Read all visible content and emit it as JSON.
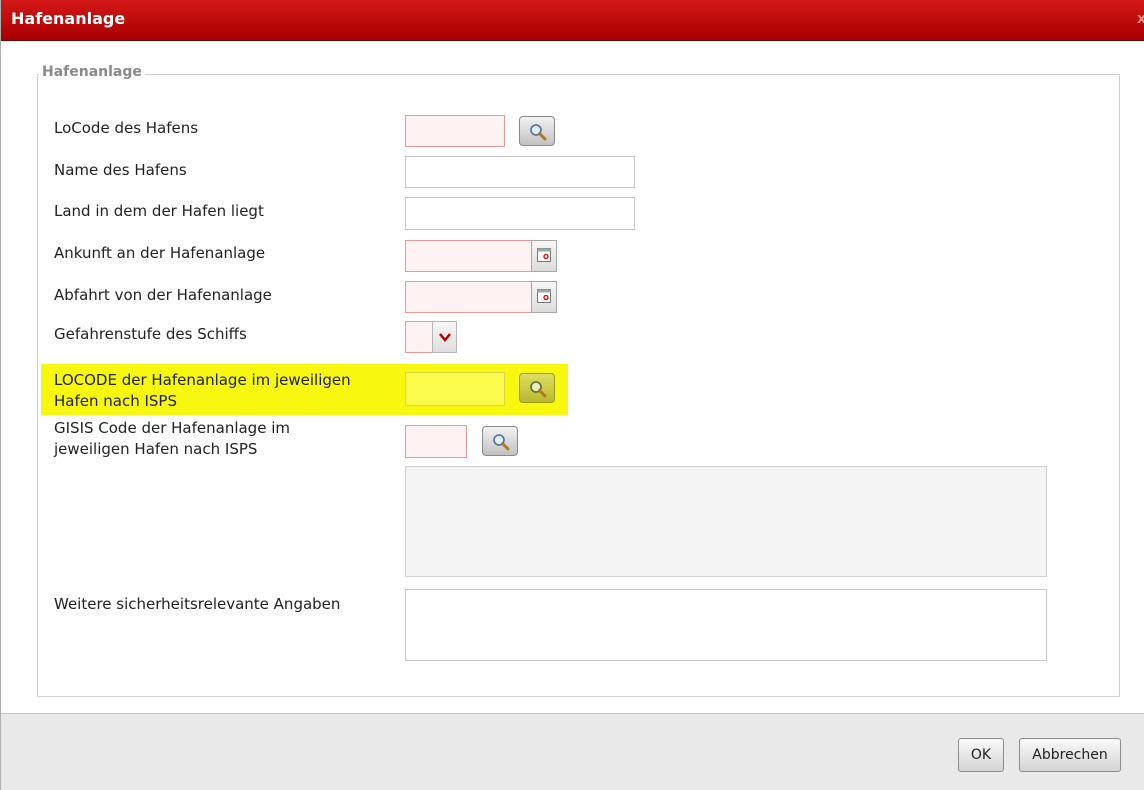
{
  "window": {
    "title": "Hafenanlage",
    "close_label": "x"
  },
  "fieldset": {
    "legend": "Hafenanlage"
  },
  "fields": {
    "locode": {
      "label": "LoCode des Hafens",
      "value": ""
    },
    "port_name": {
      "label": "Name des Hafens",
      "value": ""
    },
    "country": {
      "label": "Land in dem der Hafen liegt",
      "value": ""
    },
    "arrival": {
      "label": "Ankunft an der Hafenanlage",
      "value": ""
    },
    "departure": {
      "label": "Abfahrt von der Hafenanlage",
      "value": ""
    },
    "security_level": {
      "label": "Gefahrenstufe des Schiffs",
      "value": ""
    },
    "facility_locode": {
      "label_line1": "LOCODE der Hafenanlage im jeweiligen",
      "label_line2": "Hafen nach ISPS",
      "value": ""
    },
    "gisis_code": {
      "label_line1": "GISIS Code der Hafenanlage im",
      "label_line2": "jeweiligen Hafen nach ISPS",
      "value": ""
    },
    "further_info": {
      "label": "Weitere sicherheitsrelevante Angaben",
      "value": ""
    }
  },
  "buttons": {
    "ok": "OK",
    "cancel": "Abbrechen"
  },
  "colors": {
    "titlebar": "#c00d0d",
    "required_border": "#e69a9a",
    "highlight": "#f7f70f"
  },
  "icons": [
    "search-icon",
    "calendar-icon",
    "chevron-down-icon",
    "close-icon"
  ]
}
